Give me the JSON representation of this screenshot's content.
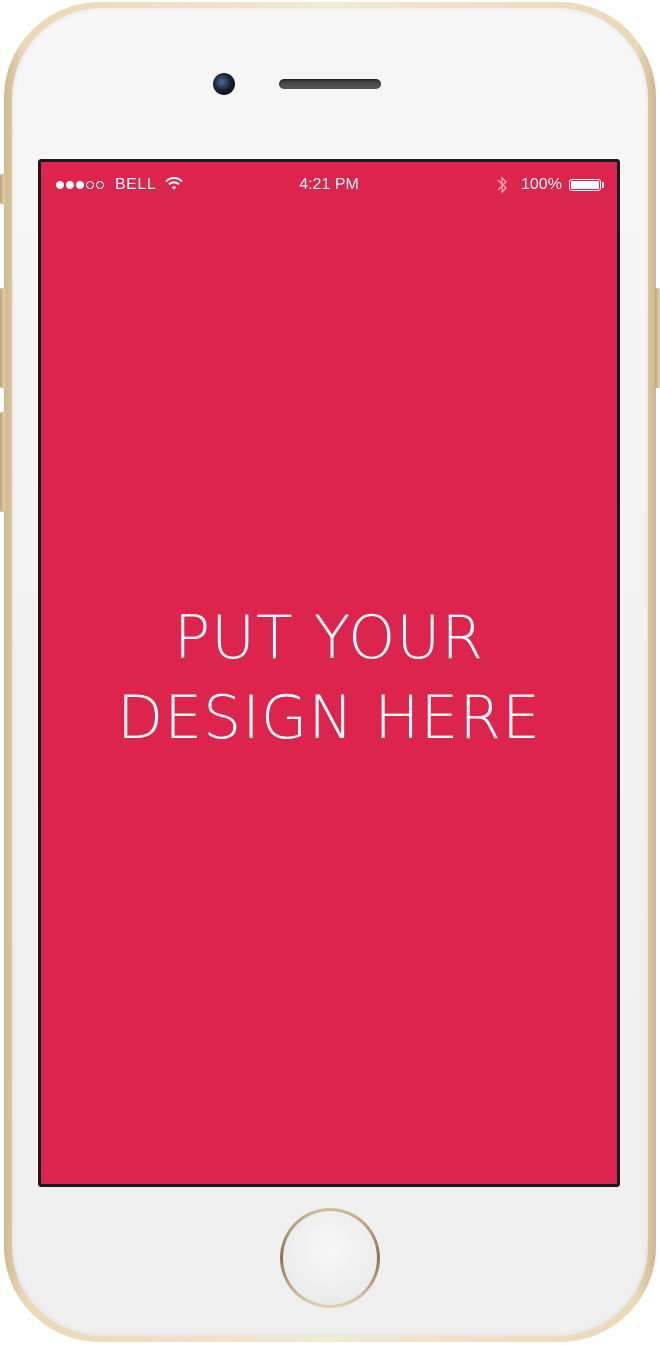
{
  "status_bar": {
    "signal_dots": [
      "on",
      "on",
      "on",
      "off",
      "off"
    ],
    "carrier": "BELL",
    "time": "4:21 PM",
    "battery_percent": "100%",
    "icons": {
      "wifi": "wifi-icon",
      "bluetooth": "bluetooth-icon",
      "battery": "battery-icon"
    }
  },
  "screen": {
    "line1": "PUT YOUR",
    "line2": "DESIGN HERE",
    "background_color": "#dc244c"
  },
  "device": {
    "frame_color": "#e8d6b2"
  }
}
